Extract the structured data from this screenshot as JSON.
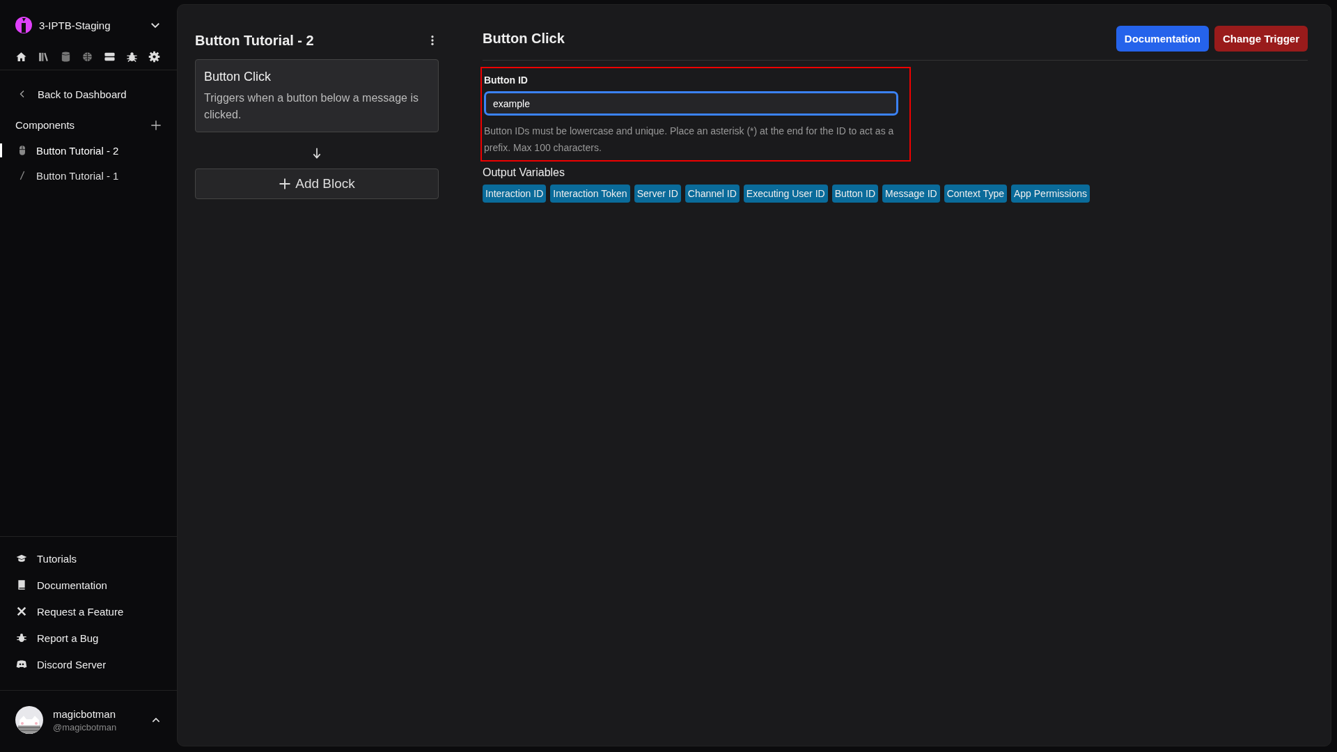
{
  "workspace": {
    "name": "3-IPTB-Staging"
  },
  "sidebar": {
    "back_link": "Back to Dashboard",
    "section_title": "Components",
    "components": [
      {
        "label": "Button Tutorial - 2",
        "kind": "button",
        "selected": true
      },
      {
        "label": "Button Tutorial - 1",
        "kind": "slash",
        "selected": false
      }
    ],
    "links": [
      {
        "label": "Tutorials",
        "kind": "cap"
      },
      {
        "label": "Documentation",
        "kind": "book"
      },
      {
        "label": "Request a Feature",
        "kind": "tools"
      },
      {
        "label": "Report a Bug",
        "kind": "bug"
      },
      {
        "label": "Discord Server",
        "kind": "chat"
      }
    ],
    "user": {
      "name": "magicbotman",
      "handle": "@magicbotman"
    }
  },
  "flow": {
    "title": "Button Tutorial - 2",
    "trigger": {
      "title": "Button Click",
      "description": "Triggers when a button below a message is clicked."
    },
    "add_button": "Add Block"
  },
  "editor": {
    "title": "Button Click",
    "buttons": [
      {
        "label": "Documentation",
        "kind": "primary"
      },
      {
        "label": "Change Trigger",
        "kind": "danger"
      }
    ],
    "field": {
      "label": "Button ID",
      "value": "example",
      "focused": true,
      "highlighted": true,
      "help": "Button IDs must be lowercase and unique. Place an asterisk (*) at the end for the ID to act as a prefix. Max 100 characters."
    },
    "output_title": "Output Variables",
    "variables": [
      "Interaction ID",
      "Interaction Token",
      "Server ID",
      "Channel ID",
      "Executing User ID",
      "Button ID",
      "Message ID",
      "Context Type",
      "App Permissions"
    ]
  }
}
